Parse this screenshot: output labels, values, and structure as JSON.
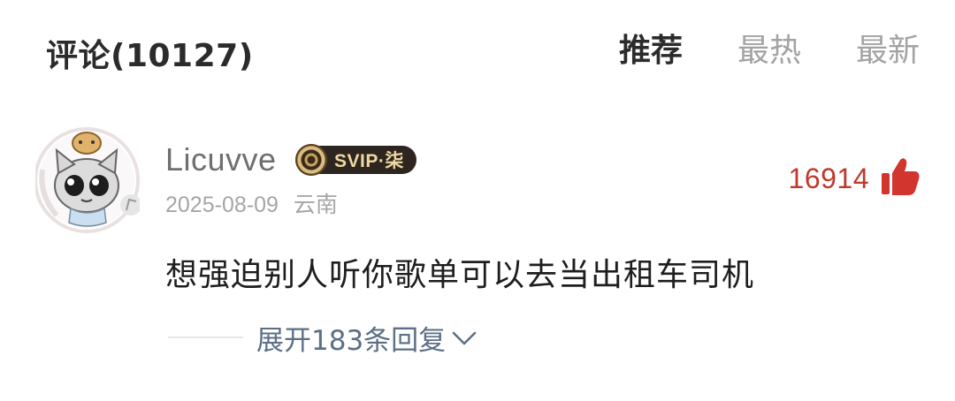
{
  "header": {
    "title": "评论(10127)",
    "tabs": [
      {
        "label": "推荐",
        "active": true
      },
      {
        "label": "最热",
        "active": false
      },
      {
        "label": "最新",
        "active": false
      }
    ]
  },
  "comment": {
    "username": "Licuvve",
    "vip_badge": "SVIP·柒",
    "date": "2025-08-09",
    "location": "云南",
    "like_count": "16914",
    "text": "想强迫别人听你歌单可以去当出租车司机",
    "expand_label": "展开183条回复"
  },
  "colors": {
    "accent_like": "#c0392b",
    "link": "#5b6f86",
    "vip_dark": "#2d2620",
    "vip_gold": "#f0d7a2"
  },
  "icons": {
    "like": "thumbs-up-icon",
    "expand": "chevron-down-icon",
    "vip": "vinyl-disc-icon"
  }
}
